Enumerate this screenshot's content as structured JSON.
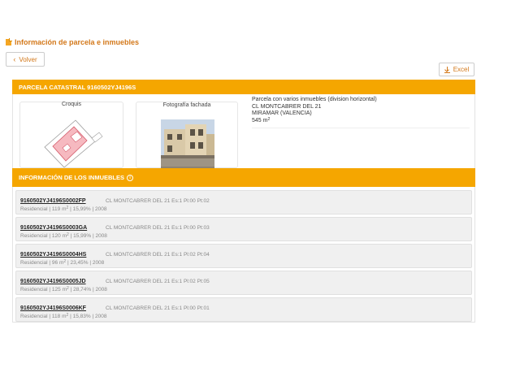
{
  "header": {
    "title": "Información de parcela e inmuebles"
  },
  "toolbar": {
    "back_label": "Volver",
    "excel_label": "Excel"
  },
  "parcel": {
    "bar_title": "PARCELA CATASTRAL 9160502YJ4196S",
    "croquis_label": "Croquis",
    "photo_label": "Fotografía fachada",
    "description": "Parcela con varios inmuebles (division horizontal)",
    "address": "CL MONTCABRER DEL 21",
    "locality": "MIRAMAR (VALENCIA)",
    "surface": "545 m",
    "surface_unit_sup": "2"
  },
  "inmuebles": {
    "bar_title": "INFORMACIÓN DE LOS INMUEBLES",
    "items": [
      {
        "ref": "9160502YJ4196S0002FP",
        "address": "CL MONTCABRER DEL 21 Es:1 Pl:00 Pt:02",
        "use": "Residencial",
        "area": "119 m",
        "percent": "15,99%",
        "year": "2008"
      },
      {
        "ref": "9160502YJ4196S0003GA",
        "address": "CL MONTCABRER DEL 21 Es:1 Pl:00 Pt:03",
        "use": "Residencial",
        "area": "120 m",
        "percent": "15,99%",
        "year": "2008"
      },
      {
        "ref": "9160502YJ4196S0004HS",
        "address": "CL MONTCABRER DEL 21 Es:1 Pl:02 Pt:04",
        "use": "Residencial",
        "area": "96 m",
        "percent": "23,45%",
        "year": "2008"
      },
      {
        "ref": "9160502YJ4196S0005JD",
        "address": "CL MONTCABRER DEL 21 Es:1 Pl:02 Pt:05",
        "use": "Residencial",
        "area": "125 m",
        "percent": "28,74%",
        "year": "2008"
      },
      {
        "ref": "9160502YJ4196S0006KF",
        "address": "CL MONTCABRER DEL 21 Es:1 Pl:00 Pt:01",
        "use": "Residencial",
        "area": "118 m",
        "percent": "15,83%",
        "year": "2008"
      }
    ]
  },
  "colors": {
    "accent": "#f5a600",
    "title_text": "#d3781a"
  }
}
